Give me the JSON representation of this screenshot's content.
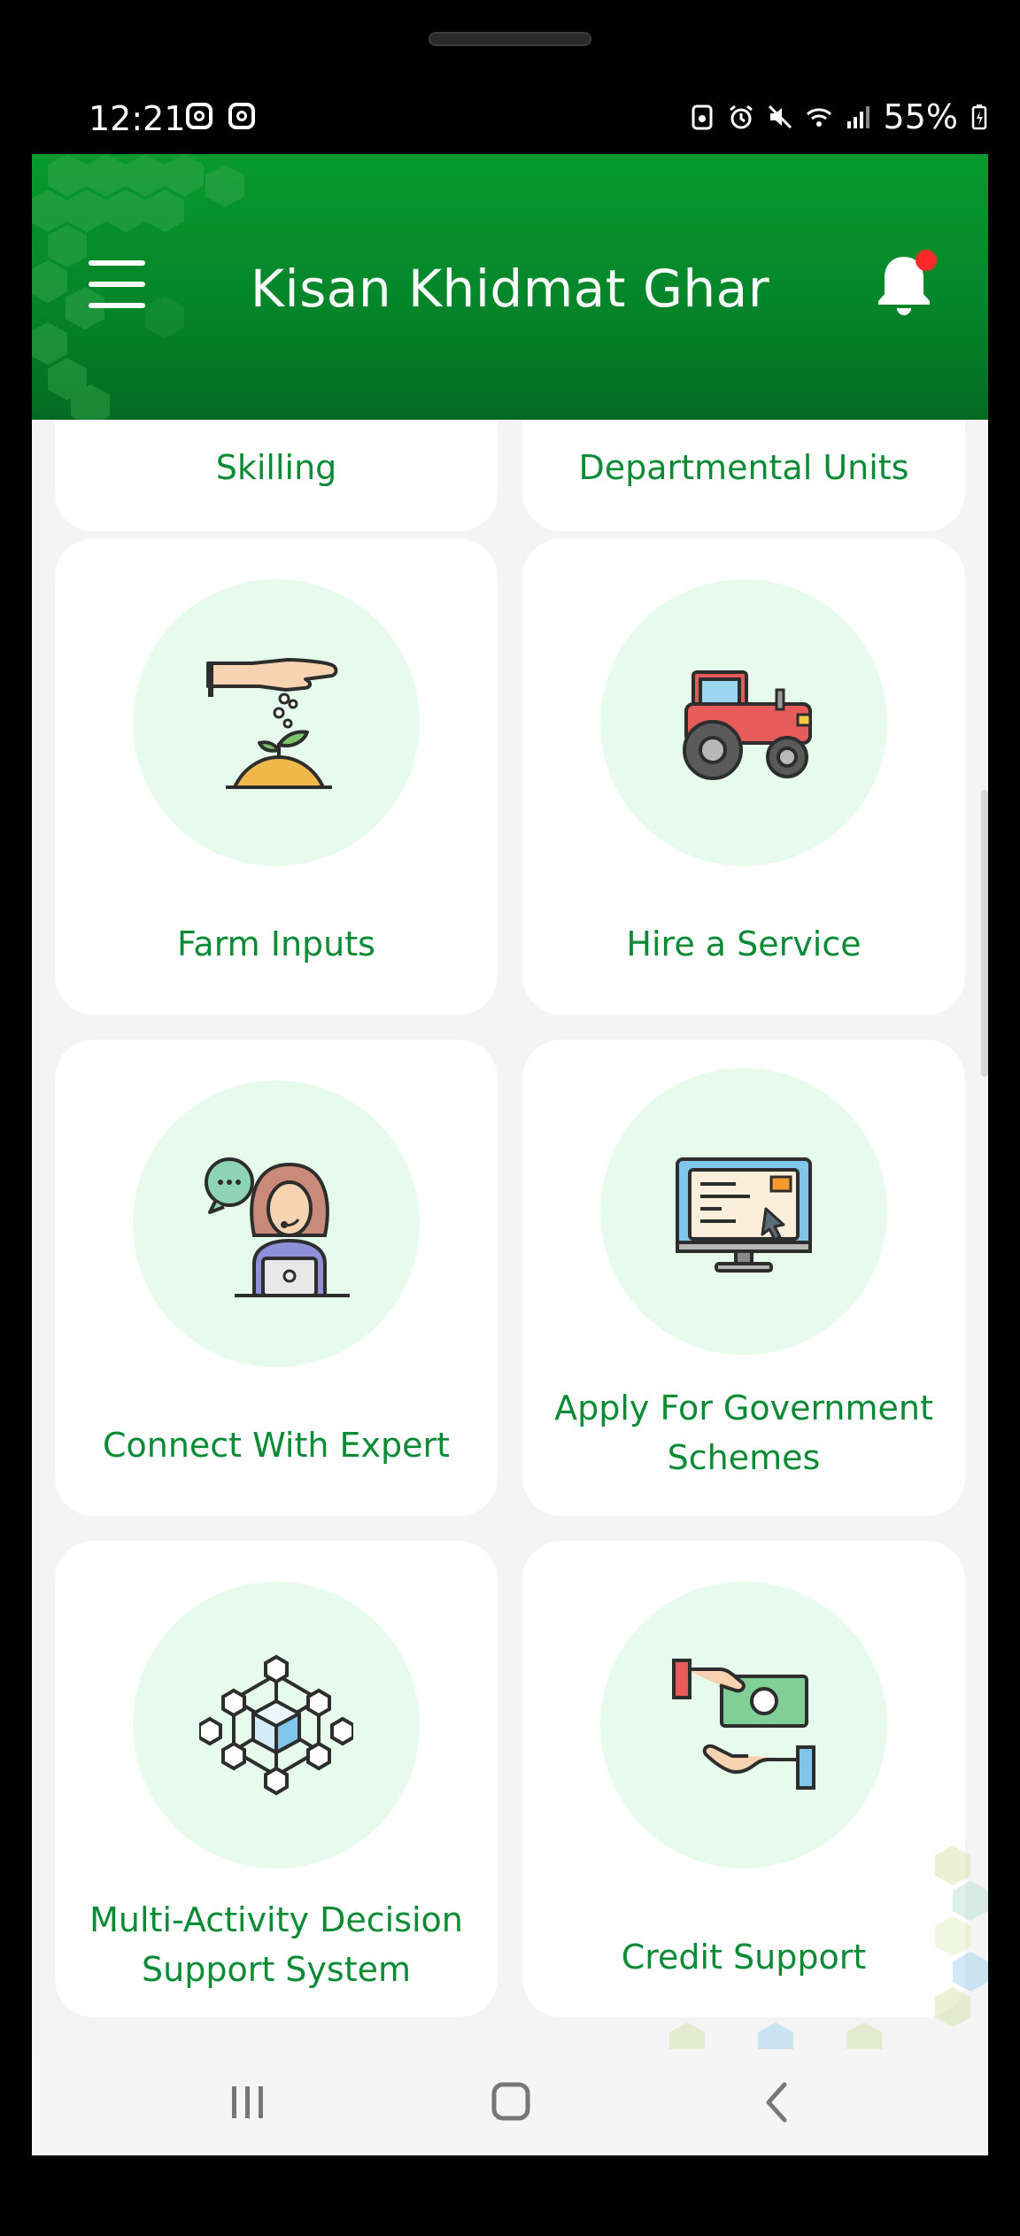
{
  "status_bar": {
    "time": "12:21",
    "battery": "55%"
  },
  "header": {
    "title": "Kisan Khidmat Ghar"
  },
  "tiles": [
    {
      "label": "Skilling",
      "icon": "skilling-icon"
    },
    {
      "label": "Departmental Units",
      "icon": "departmental-units-icon"
    },
    {
      "label": "Farm Inputs",
      "icon": "seeds-hand-icon"
    },
    {
      "label": "Hire a Service",
      "icon": "tractor-icon"
    },
    {
      "label": "Connect With Expert",
      "icon": "expert-headset-icon"
    },
    {
      "label": "Apply For Government Schemes",
      "icon": "computer-form-icon"
    },
    {
      "label": "Multi-Activity Decision Support System",
      "icon": "network-cube-icon"
    },
    {
      "label": "Credit Support",
      "icon": "money-hands-icon"
    }
  ],
  "colors": {
    "header_green": "#079a2e",
    "label_green": "#0b8a36",
    "circle_bg": "#e6fbec",
    "notification_dot": "#ff2a2a"
  }
}
